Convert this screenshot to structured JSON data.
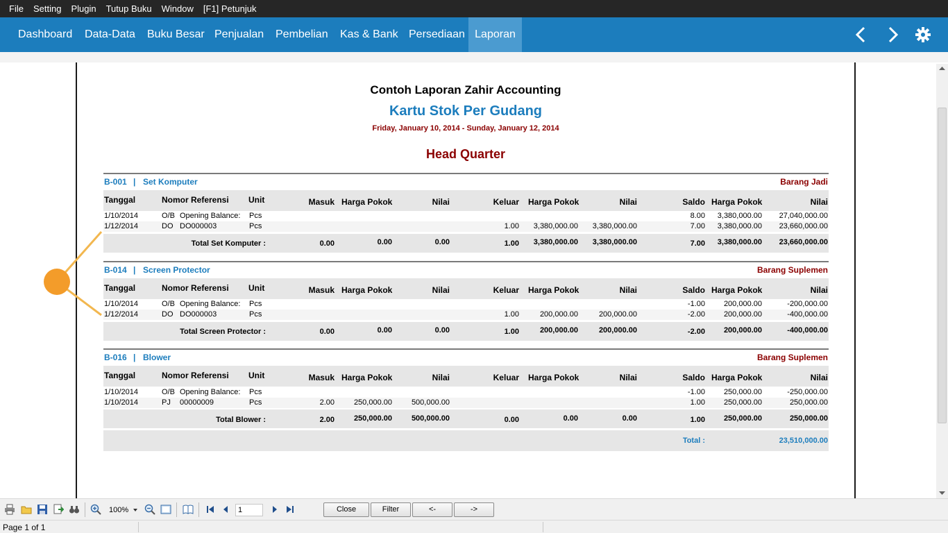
{
  "menu": [
    "File",
    "Setting",
    "Plugin",
    "Tutup Buku",
    "Window",
    "[F1] Petunjuk"
  ],
  "nav": {
    "items": [
      "Dashboard",
      "Data-Data",
      "Buku Besar",
      "Penjualan",
      "Pembelian",
      "Kas & Bank",
      "Persediaan",
      "Laporan"
    ],
    "active": "Laporan",
    "icons": [
      "chevron-left-icon",
      "chevron-right-icon",
      "gear-icon"
    ]
  },
  "report": {
    "company": "Contoh Laporan Zahir Accounting",
    "title": "Kartu Stok Per Gudang",
    "period": "Friday, January 10, 2014 - Sunday, January 12, 2014",
    "warehouse": "Head Quarter",
    "columns": [
      "Tanggal",
      "Nomor Referensi",
      "Unit",
      "Masuk",
      "Harga Pokok",
      "Nilai",
      "Keluar",
      "Harga Pokok",
      "Nilai",
      "Saldo",
      "Harga Pokok",
      "Nilai"
    ],
    "groups": [
      {
        "code": "B-001",
        "sep": "|",
        "name": "Set Komputer",
        "category": "Barang Jadi",
        "rows": [
          [
            "1/10/2014",
            "O/B",
            "Opening Balance:",
            "Pcs",
            "",
            "",
            "",
            "",
            "",
            "",
            "8.00",
            "3,380,000.00",
            "27,040,000.00"
          ],
          [
            "1/12/2014",
            "DO",
            "DO000003",
            "Pcs",
            "",
            "",
            "",
            "1.00",
            "3,380,000.00",
            "3,380,000.00",
            "7.00",
            "3,380,000.00",
            "23,660,000.00"
          ]
        ],
        "total_label": "Total Set Komputer :",
        "totals": [
          "0.00",
          "0.00",
          "0.00",
          "1.00",
          "3,380,000.00",
          "3,380,000.00",
          "7.00",
          "3,380,000.00",
          "23,660,000.00"
        ]
      },
      {
        "code": "B-014",
        "sep": "|",
        "name": "Screen Protector",
        "category": "Barang Suplemen",
        "rows": [
          [
            "1/10/2014",
            "O/B",
            "Opening Balance:",
            "Pcs",
            "",
            "",
            "",
            "",
            "",
            "",
            "-1.00",
            "200,000.00",
            "-200,000.00"
          ],
          [
            "1/12/2014",
            "DO",
            "DO000003",
            "Pcs",
            "",
            "",
            "",
            "1.00",
            "200,000.00",
            "200,000.00",
            "-2.00",
            "200,000.00",
            "-400,000.00"
          ]
        ],
        "total_label": "Total Screen Protector :",
        "totals": [
          "0.00",
          "0.00",
          "0.00",
          "1.00",
          "200,000.00",
          "200,000.00",
          "-2.00",
          "200,000.00",
          "-400,000.00"
        ]
      },
      {
        "code": "B-016",
        "sep": "|",
        "name": "Blower",
        "category": "Barang Suplemen",
        "rows": [
          [
            "1/10/2014",
            "O/B",
            "Opening Balance:",
            "Pcs",
            "",
            "",
            "",
            "",
            "",
            "",
            "-1.00",
            "250,000.00",
            "-250,000.00"
          ],
          [
            "1/10/2014",
            "PJ",
            "00000009",
            "Pcs",
            "2.00",
            "250,000.00",
            "500,000.00",
            "",
            "",
            "",
            "1.00",
            "250,000.00",
            "250,000.00"
          ]
        ],
        "total_label": "Total Blower :",
        "totals": [
          "2.00",
          "250,000.00",
          "500,000.00",
          "0.00",
          "0.00",
          "0.00",
          "1.00",
          "250,000.00",
          "250,000.00"
        ]
      }
    ],
    "grand_total_label": "Total :",
    "grand_total": "23,510,000.00"
  },
  "toolbar": {
    "zoom": "100%",
    "page_input": "1",
    "close_label": "Close",
    "filter_label": "Filter",
    "prev_label": "<-",
    "next_label": "->",
    "icons": [
      "print-icon",
      "open-icon",
      "save-icon",
      "export-icon",
      "find-icon",
      "zoom-in-icon",
      "zoom-out-icon",
      "page-width-icon",
      "book-icon",
      "first-page-icon",
      "prev-page-icon",
      "next-page-icon",
      "last-page-icon"
    ]
  },
  "status": {
    "page": "Page 1 of 1"
  },
  "colors": {
    "nav": "#1c7dbd",
    "nav_active": "#4b9bd0",
    "menubar": "#262626",
    "title": "#1c7dbd",
    "period": "#8b0000",
    "callout": "#f39c2a"
  }
}
